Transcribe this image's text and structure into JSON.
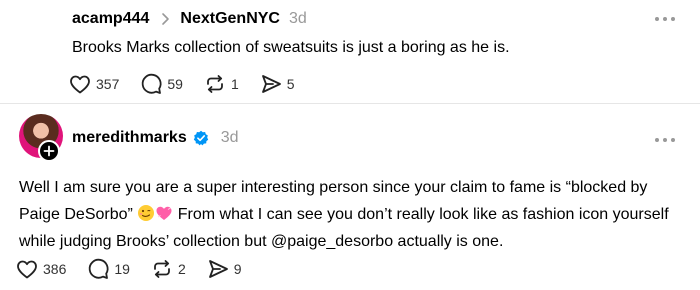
{
  "post1": {
    "username": "acamp444",
    "reply_target": "NextGenNYC",
    "time": "3d",
    "text": "Brooks Marks collection of sweatsuits is just a boring as he is.",
    "likes": "357",
    "comments": "59",
    "reposts": "1",
    "shares": "5"
  },
  "post2": {
    "username": "meredithmarks",
    "time": "3d",
    "text_1": "Well I am sure you are a super interesting person since your claim to fame is “blocked by Paige DeSorbo” ",
    "text_2": " From what I can see you don’t really look like as fashion icon yourself while judging Brooks’ collection but @paige_desorbo actually is one.",
    "likes": "386",
    "comments": "19",
    "reposts": "2",
    "shares": "9"
  },
  "icons": {
    "heart": "heart-icon",
    "comment": "comment-icon",
    "repost": "repost-icon",
    "share": "share-icon",
    "more": "more-icon",
    "verified": "verified-icon",
    "follow": "plus-icon"
  },
  "colors": {
    "verified_blue": "#0095f6",
    "muted_text": "#999999",
    "avatar_pink": "#e0147a"
  }
}
